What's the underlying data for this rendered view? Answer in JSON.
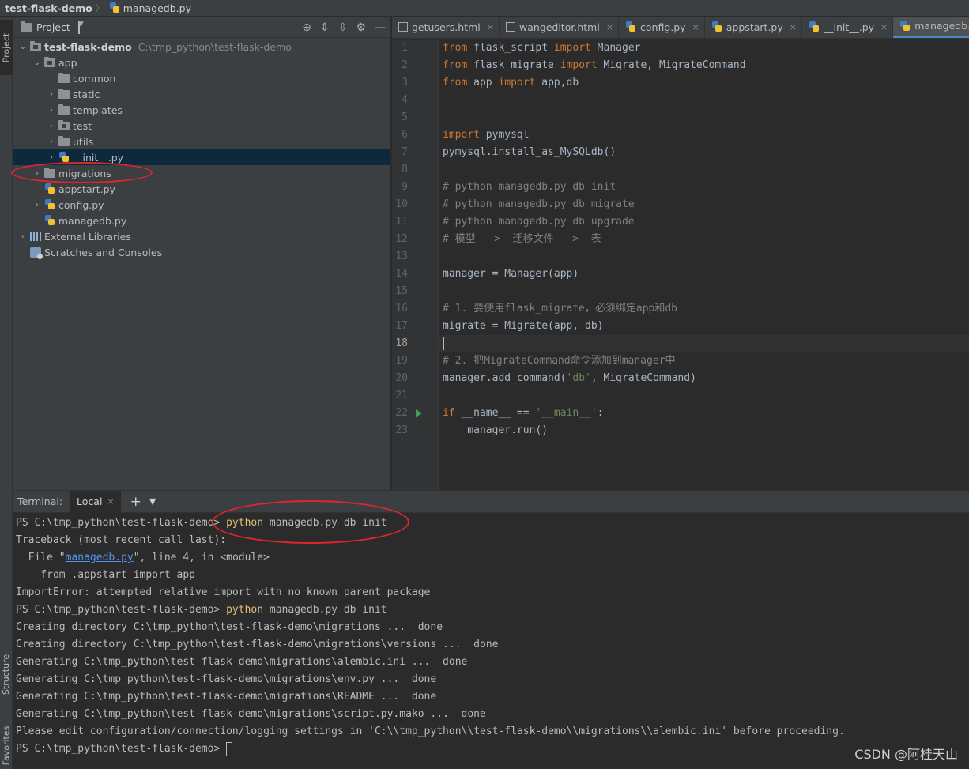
{
  "topbar": {
    "project": "test-flask-demo",
    "file": "managedb.py"
  },
  "left_strip": {
    "project": "Project",
    "structure": "Structure",
    "favorites": "Favorites"
  },
  "project_panel": {
    "title": "Project"
  },
  "tree": {
    "root": {
      "name": "test-flask-demo",
      "path": "C:\\tmp_python\\test-flask-demo"
    },
    "app": "app",
    "common": "common",
    "static": "static",
    "templates": "templates",
    "test": "test",
    "utils": "utils",
    "init": "__init__.py",
    "migrations": "migrations",
    "appstart": "appstart.py",
    "config": "config.py",
    "managedb": "managedb.py",
    "ext_libs": "External Libraries",
    "scratches": "Scratches and Consoles"
  },
  "editor": {
    "tabs": [
      {
        "label": "getusers.html"
      },
      {
        "label": "wangeditor.html"
      },
      {
        "label": "config.py"
      },
      {
        "label": "appstart.py"
      },
      {
        "label": "__init__.py"
      },
      {
        "label": "managedb.py"
      }
    ],
    "line_numbers": [
      "1",
      "2",
      "3",
      "4",
      "5",
      "6",
      "7",
      "8",
      "9",
      "10",
      "11",
      "12",
      "13",
      "14",
      "15",
      "16",
      "17",
      "18",
      "19",
      "20",
      "21",
      "22",
      "23"
    ],
    "code": {
      "l1_kw1": "from",
      "l1_a": " flask_script ",
      "l1_kw2": "import",
      "l1_b": " Manager",
      "l2_kw1": "from",
      "l2_a": " flask_migrate ",
      "l2_kw2": "import",
      "l2_b": " Migrate, MigrateCommand",
      "l3_kw1": "from",
      "l3_a": " app ",
      "l3_kw2": "import",
      "l3_b": " app,db",
      "l6_kw": "import",
      "l6_a": " pymysql",
      "l7": "pymysql.install_as_MySQLdb()",
      "l9": "# python managedb.py db init",
      "l10": "# python managedb.py db migrate",
      "l11": "# python managedb.py db upgrade",
      "l12": "# 模型  ->  迁移文件  ->  表",
      "l14": "manager = Manager(app)",
      "l16": "# 1. 要使用flask_migrate，必须绑定app和db",
      "l17": "migrate = Migrate(app, db)",
      "l19": "# 2. 把MigrateCommand命令添加到manager中",
      "l20_a": "manager.add_command(",
      "l20_str": "'db'",
      "l20_b": ", MigrateCommand)",
      "l22_kw": "if",
      "l22_a": " __name__ == ",
      "l22_str": "'__main__'",
      "l22_b": ":",
      "l23": "    manager.run()"
    }
  },
  "terminal": {
    "label": "Terminal:",
    "tab": "Local",
    "lines": {
      "t1_prompt": "PS C:\\tmp_python\\test-flask-demo> ",
      "t1_py": "python",
      "t1_rest": " managedb.py db init",
      "t2": "Traceback (most recent call last):",
      "t3_a": "  File \"",
      "t3_link": "managedb.py",
      "t3_b": "\", line 4, in <module>",
      "t4": "    from .appstart import app",
      "t5": "ImportError: attempted relative import with no known parent package",
      "t6_prompt": "PS C:\\tmp_python\\test-flask-demo> ",
      "t6_py": "python",
      "t6_rest": " managedb.py db init",
      "t7": "Creating directory C:\\tmp_python\\test-flask-demo\\migrations ...  done",
      "t8": "Creating directory C:\\tmp_python\\test-flask-demo\\migrations\\versions ...  done",
      "t9": "Generating C:\\tmp_python\\test-flask-demo\\migrations\\alembic.ini ...  done",
      "t10": "Generating C:\\tmp_python\\test-flask-demo\\migrations\\env.py ...  done",
      "t11": "Generating C:\\tmp_python\\test-flask-demo\\migrations\\README ...  done",
      "t12": "Generating C:\\tmp_python\\test-flask-demo\\migrations\\script.py.mako ...  done",
      "t13": "Please edit configuration/connection/logging settings in 'C:\\\\tmp_python\\\\test-flask-demo\\\\migrations\\\\alembic.ini' before proceeding.",
      "t14_prompt": "PS C:\\tmp_python\\test-flask-demo> "
    }
  },
  "watermark": "CSDN @阿桂天山",
  "colors": {
    "annotation": "#e0252d",
    "keyword": "#cc7832",
    "comment": "#808080",
    "string": "#6a8759",
    "selection": "#0d293e"
  }
}
